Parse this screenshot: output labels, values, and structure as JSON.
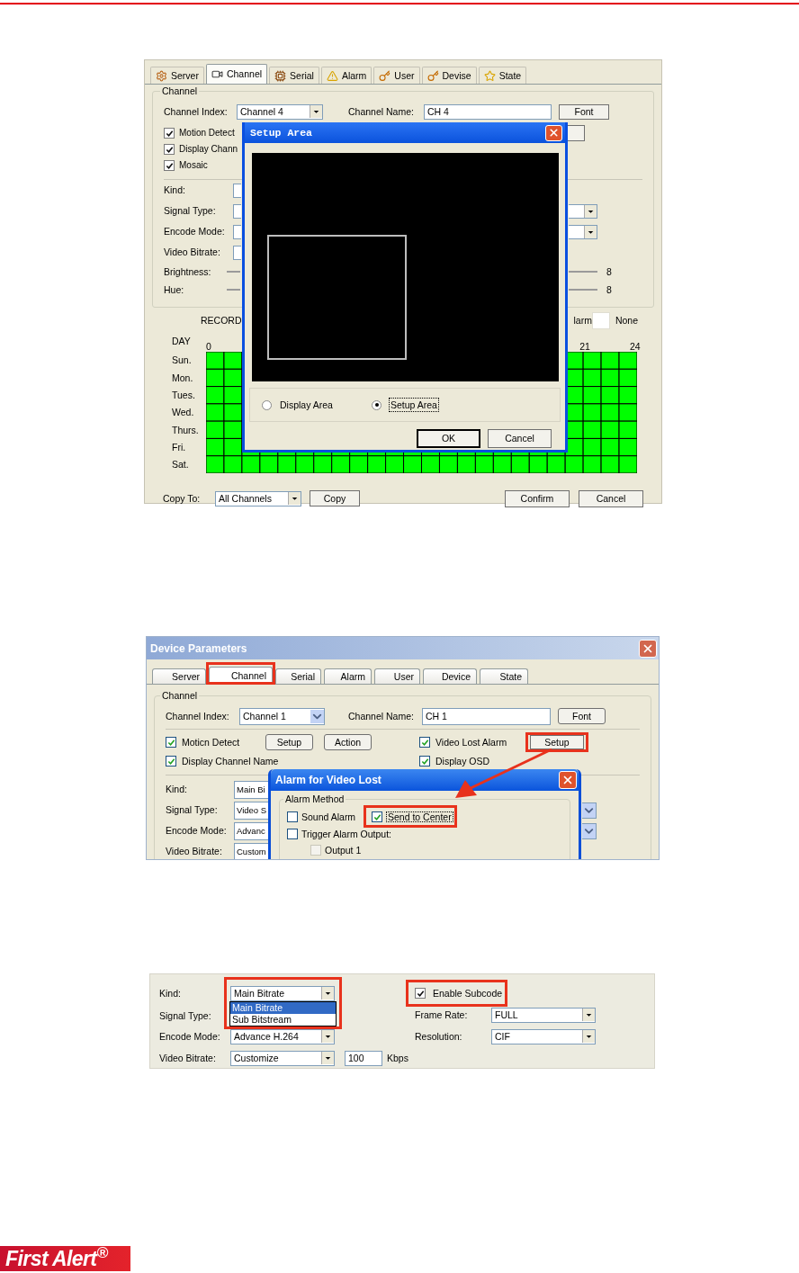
{
  "figure_1": {
    "tabs": [
      {
        "label": "Server",
        "selected": false
      },
      {
        "label": "Channel",
        "selected": true
      },
      {
        "label": "Serial",
        "selected": false
      },
      {
        "label": "Alarm",
        "selected": false
      },
      {
        "label": "User",
        "selected": false
      },
      {
        "label": "Devise",
        "selected": false
      },
      {
        "label": "State",
        "selected": false
      }
    ],
    "group_label": "Channel",
    "channel_index": {
      "label": "Channel Index:",
      "value": "Channel 4"
    },
    "channel_name": {
      "label": "Channel Name:",
      "value": "CH 4"
    },
    "font_button": "Font",
    "checkboxes": [
      {
        "label": "Motion Detect",
        "checked": true
      },
      {
        "label": "Display Chann",
        "checked": true
      },
      {
        "label": "Mosaic",
        "checked": true
      }
    ],
    "fields": [
      {
        "label": "Kind:",
        "kind": "plain"
      },
      {
        "label": "Signal Type:",
        "kind": "with_select"
      },
      {
        "label": "Encode Mode:",
        "kind": "with_select"
      },
      {
        "label": "Video Bitrate:",
        "kind": "plain"
      }
    ],
    "sliders": [
      {
        "label": "Brightness:",
        "reading": "8"
      },
      {
        "label": "Hue:",
        "reading": "8"
      }
    ],
    "schedule": {
      "title": "RECORD",
      "day_label": "DAY",
      "hours": [
        "0",
        "21",
        "24"
      ],
      "days": [
        "Sun.",
        "Mon.",
        "Tues.",
        "Wed.",
        "Thurs.",
        "Fri.",
        "Sat."
      ],
      "legend": [
        {
          "label": "larm"
        },
        {
          "label": "None",
          "color": "#ffffff"
        }
      ]
    },
    "copy_to": {
      "label": "Copy To:",
      "value": "All Channels",
      "button": "Copy"
    },
    "buttons": [
      "Confirm",
      "Cancel"
    ],
    "dialog": {
      "title": "Setup Area",
      "radios": [
        {
          "label": "Display Area",
          "selected": false
        },
        {
          "label": "Setup Area",
          "selected": true
        }
      ],
      "buttons": [
        "OK",
        "Cancel"
      ]
    }
  },
  "figure_2": {
    "title": "Device Parameters",
    "tabs": [
      {
        "label": "Server",
        "selected": false,
        "highlighted": false
      },
      {
        "label": "Channel",
        "selected": true,
        "highlighted": true
      },
      {
        "label": "Serial",
        "selected": false,
        "highlighted": false
      },
      {
        "label": "Alarm",
        "selected": false,
        "highlighted": false
      },
      {
        "label": "User",
        "selected": false,
        "highlighted": false
      },
      {
        "label": "Device",
        "selected": false,
        "highlighted": false
      },
      {
        "label": "State",
        "selected": false,
        "highlighted": false
      }
    ],
    "group_label": "Channel",
    "channel_index": {
      "label": "Channel Index:",
      "value": "Channel 1"
    },
    "channel_name": {
      "label": "Channel Name:",
      "value": "CH 1"
    },
    "font_button": "Font",
    "motion_detect": {
      "label": "Moticn Detect",
      "checked": true,
      "buttons": [
        "Setup",
        "Action"
      ]
    },
    "video_lost_alarm": {
      "label": "Video Lost Alarm",
      "checked": true,
      "button": "Setup",
      "highlighted": true
    },
    "display_channel_name": {
      "label": "Display Channel Name",
      "checked": true
    },
    "display_osd": {
      "label": "Display OSD",
      "checked": true
    },
    "fields": [
      {
        "label": "Kind:",
        "value": "Main Bi",
        "kind": "plain"
      },
      {
        "label": "Signal Type:",
        "value": "Video S",
        "kind": "with_select"
      },
      {
        "label": "Encode Mode:",
        "value": "Advanc",
        "kind": "with_select"
      },
      {
        "label": "Video Bitrate:",
        "value": "Custom",
        "kind": "plain"
      }
    ],
    "dialog": {
      "title": "Alarm for Video Lost",
      "group_label": "Alarm Method",
      "options": [
        {
          "label": "Sound Alarm",
          "checked": false,
          "highlighted": false
        },
        {
          "label": "Send to Center",
          "checked": true,
          "highlighted": true
        }
      ],
      "trigger": {
        "label": "Trigger Alarm Output:",
        "checked": false,
        "children": [
          {
            "label": "Output 1",
            "checked": false,
            "disabled": true
          }
        ]
      }
    }
  },
  "figure_3": {
    "kind_select": {
      "label": "Kind:",
      "value": "Main Bitrate",
      "highlighted": true,
      "options": [
        {
          "label": "Main Bitrate",
          "selected": true
        },
        {
          "label": "Sub Bitstream",
          "selected": false
        }
      ]
    },
    "signal_type_label": "Signal Type:",
    "encode_mode": {
      "label": "Encode Mode:",
      "value": "Advance H.264"
    },
    "video_bitrate": {
      "label": "Video Bitrate:",
      "value": "Customize",
      "amount": "100",
      "unit": "Kbps"
    },
    "enable_subcode": {
      "label": "Enable Subcode",
      "checked": true,
      "highlighted": true
    },
    "frame_rate": {
      "label": "Frame Rate:",
      "value": "FULL"
    },
    "resolution": {
      "label": "Resolution:",
      "value": "CIF"
    }
  },
  "footer": {
    "logo": "First Alert$^{®}$"
  }
}
